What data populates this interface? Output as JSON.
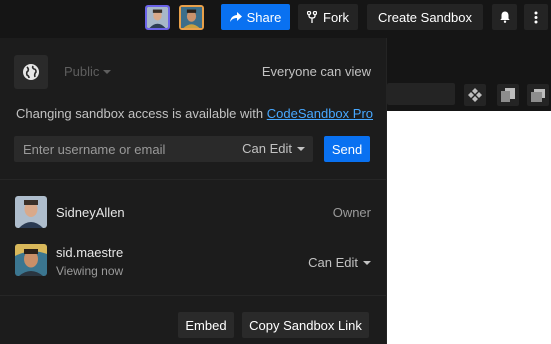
{
  "header": {
    "share_label": "Share",
    "fork_label": "Fork",
    "create_sandbox_label": "Create Sandbox"
  },
  "colors": {
    "primary": "#0971f1",
    "link": "#47a8ff",
    "avatar_ring_1": "#6b63e8",
    "avatar_ring_2": "#e8a04a"
  },
  "icons": {
    "share": "share-arrow-icon",
    "fork": "fork-icon",
    "notifications": "bell-icon",
    "more": "more-vertical-icon",
    "privacy": "globe-icon"
  },
  "share_panel": {
    "privacy_value": "Public",
    "visibility_label": "Everyone can view",
    "pro_notice_text": "Changing sandbox access is available with ",
    "pro_link_text": "CodeSandbox Pro",
    "invite_placeholder": "Enter username or email",
    "invite_value": "",
    "invite_permission": "Can Edit",
    "send_label": "Send",
    "collaborators": [
      {
        "name": "SidneyAllen",
        "status": "",
        "role": "Owner"
      },
      {
        "name": "sid.maestre",
        "status": "Viewing now",
        "role": "Can Edit"
      }
    ],
    "embed_label": "Embed",
    "copy_link_label": "Copy Sandbox Link"
  }
}
